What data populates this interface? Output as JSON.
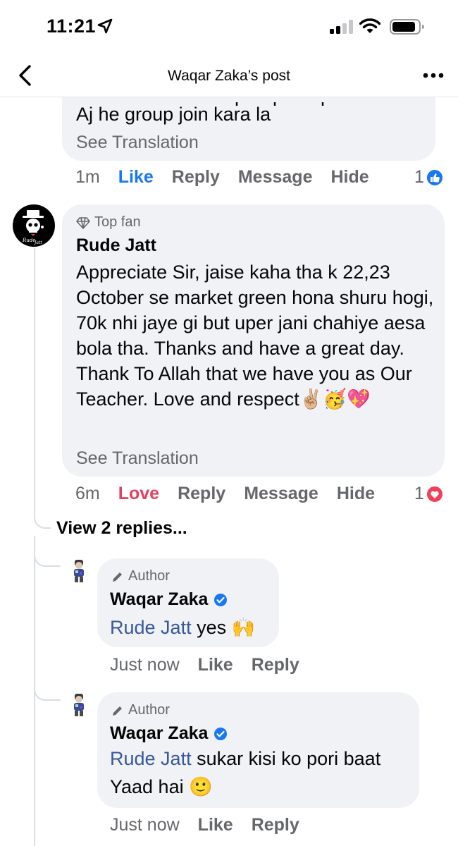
{
  "status_bar": {
    "time": "11:21"
  },
  "nav": {
    "title": "Waqar Zaka’s post"
  },
  "comment_prev": {
    "partial_line": "Aj he group join kara la",
    "see_translation": "See Translation",
    "time": "1m",
    "like": "Like",
    "reply": "Reply",
    "message": "Message",
    "hide": "Hide",
    "reaction_count": "1"
  },
  "comment_main": {
    "badge": "Top fan",
    "author": "Rude Jatt",
    "text": "Appreciate Sir, jaise kaha tha k 22,23 October se market green hona shuru hogi, 70k nhi jaye gi but uper jani chahiye aesa bola tha. Thanks and have a great day. Thank To Allah that we have you as Our Teacher. Love and respect✌🏼🥳💖",
    "see_translation": "See Translation",
    "time": "6m",
    "love": "Love",
    "reply": "Reply",
    "message": "Message",
    "hide": "Hide",
    "reaction_count": "1"
  },
  "view_replies": "View 2 replies...",
  "replies": [
    {
      "badge": "Author",
      "author": "Waqar Zaka",
      "mention": "Rude Jatt",
      "text": " yes 🙌",
      "time": "Just now",
      "like": "Like",
      "reply": "Reply"
    },
    {
      "badge": "Author",
      "author": "Waqar Zaka",
      "mention": "Rude Jatt",
      "text_line1": " sukar kisi ko pori baat",
      "text_line2": "Yaad hai 🙂",
      "time": "Just now",
      "like": "Like",
      "reply": "Reply"
    }
  ],
  "colors": {
    "link_blue": "#1877f2",
    "love_red": "#e4405f",
    "bubble_bg": "#f0f2f5",
    "secondary_text": "#65676b"
  },
  "icons": [
    "location-arrow-icon",
    "cellular-signal-icon",
    "wifi-icon",
    "battery-icon",
    "back-chevron-icon",
    "more-dots-icon",
    "diamond-icon",
    "pencil-icon",
    "verified-badge-icon",
    "like-reaction-icon",
    "love-reaction-icon"
  ]
}
